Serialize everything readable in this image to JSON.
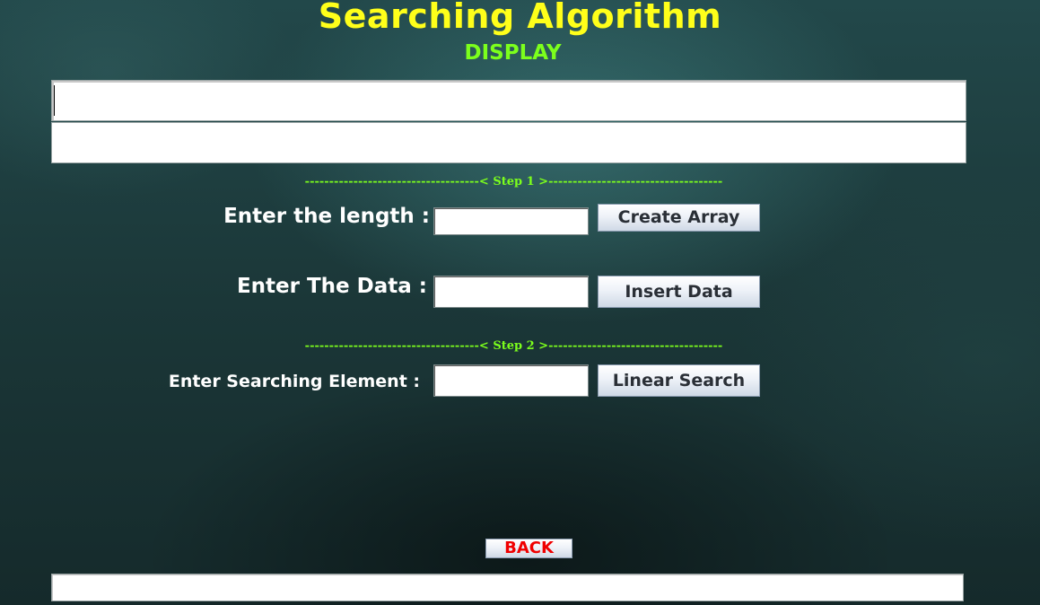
{
  "header": {
    "title": "Searching Algorithm",
    "display_label": "DISPLAY"
  },
  "display": {
    "line1": "",
    "line2": ""
  },
  "step1": {
    "divider": "------------------------------------< Step 1 >------------------------------------",
    "length_label": "Enter the length :",
    "length_value": "",
    "create_button": "Create Array",
    "data_label": "Enter The Data :",
    "data_value": "",
    "insert_button": "Insert Data"
  },
  "step2": {
    "divider": "------------------------------------< Step 2 >------------------------------------",
    "search_label": "Enter Searching Element :",
    "search_value": "",
    "linear_button": "Linear Search"
  },
  "footer": {
    "back_button": "BACK",
    "status_text": ""
  },
  "colors": {
    "title": "#ffff1a",
    "accent_green": "#7cff1c",
    "back_text": "#f00000",
    "background": "#1d3a3b"
  }
}
